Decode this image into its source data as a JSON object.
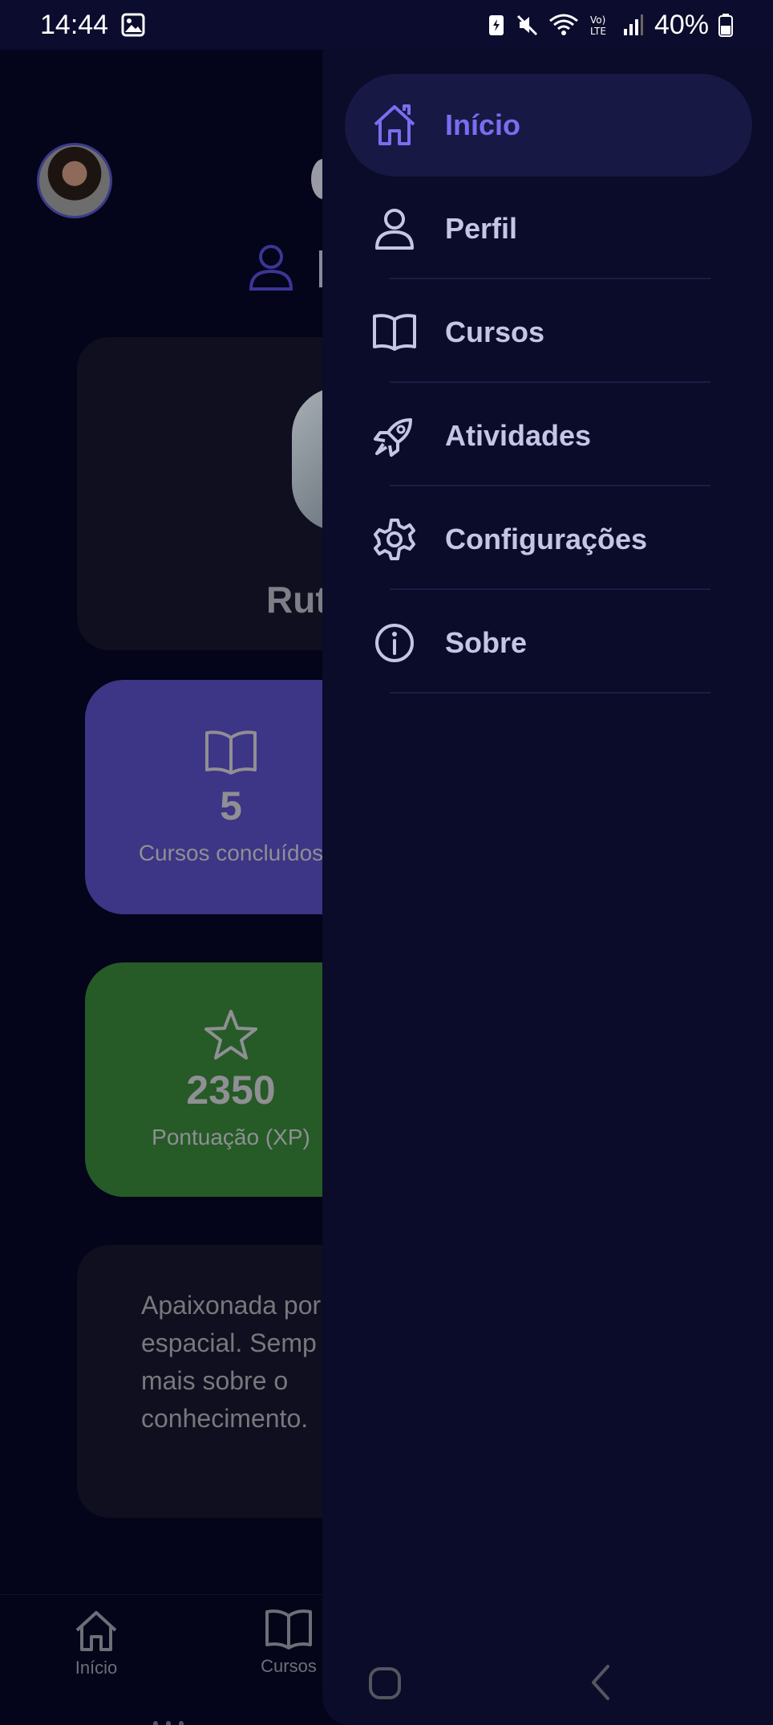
{
  "status_bar": {
    "time": "14:44",
    "battery": "40%"
  },
  "profile": {
    "name_partial": "Rut"
  },
  "stats": {
    "courses": {
      "value": "5",
      "label": "Cursos concluídos"
    },
    "xp": {
      "value": "2350",
      "label": "Pontuação (XP)"
    }
  },
  "bio": {
    "lines": [
      "Apaixonada por",
      "espacial. Semp",
      "mais sobre o",
      "conhecimento."
    ]
  },
  "bottom_nav": {
    "items": [
      {
        "label": "Início",
        "icon": "home-icon"
      },
      {
        "label": "Cursos",
        "icon": "book-icon"
      }
    ]
  },
  "drawer": {
    "items": [
      {
        "label": "Início",
        "icon": "home-icon",
        "active": true
      },
      {
        "label": "Perfil",
        "icon": "user-icon",
        "active": false
      },
      {
        "label": "Cursos",
        "icon": "book-icon",
        "active": false
      },
      {
        "label": "Atividades",
        "icon": "rocket-icon",
        "active": false
      },
      {
        "label": "Configurações",
        "icon": "gear-icon",
        "active": false
      },
      {
        "label": "Sobre",
        "icon": "info-icon",
        "active": false
      }
    ]
  },
  "colors": {
    "accent": "#7b6df0",
    "drawer_bg": "#0b0b2a",
    "courses_card": "#3d3585",
    "xp_card": "#265b27"
  }
}
